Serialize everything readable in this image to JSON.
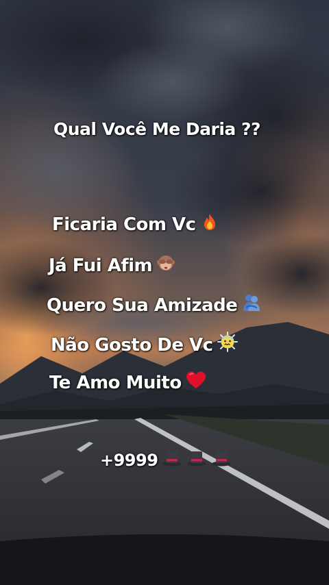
{
  "title": "Qual Você Me Daria ??",
  "options": [
    {
      "label": "Ficaria Com Vc",
      "icon": "fire-icon"
    },
    {
      "label": "Já Fui Afim",
      "icon": "see-no-evil-monkey-icon"
    },
    {
      "label": "Quero Sua Amizade",
      "icon": "people-hugging-icon"
    },
    {
      "label": "Não Gosto De Vc",
      "icon": "cold-face-icon"
    },
    {
      "label": "Te Amo Muito",
      "icon": "red-heart-icon"
    }
  ],
  "count": {
    "label": "+9999",
    "icons": [
      "top-hat-icon",
      "top-hat-icon",
      "top-hat-icon"
    ]
  },
  "colors": {
    "text": "#ffffff",
    "sky_dark": "#2c3340",
    "sunset_glow": "#d9894a",
    "road": "#2a2b2e",
    "heart": "#e0102a"
  }
}
